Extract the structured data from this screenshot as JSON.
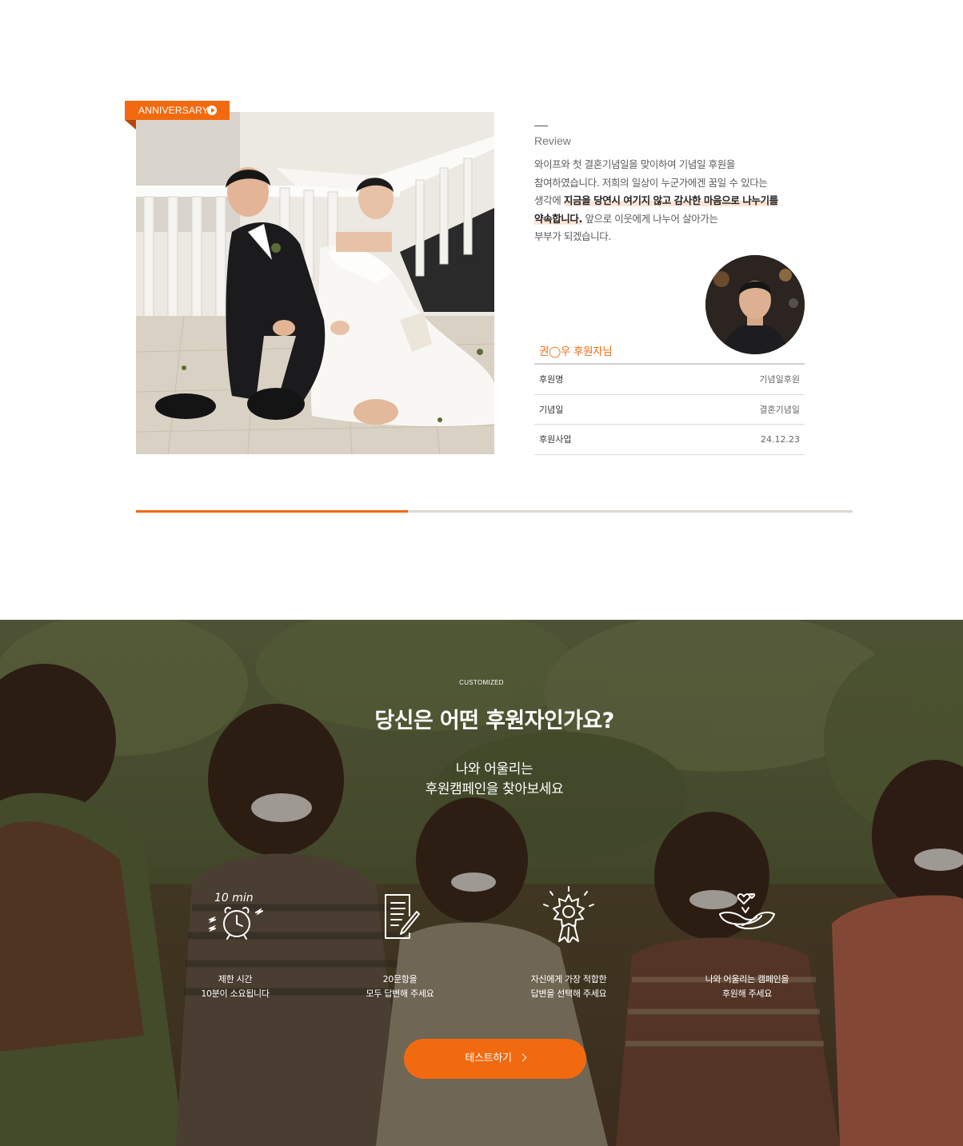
{
  "review": {
    "tag_label": "ANNIVERSARY",
    "heading": "Review",
    "text_line1": "와이프와 첫 결혼기념일을 맞이하여 기념일 후원을",
    "text_line2": "참여하였습니다. 저희의 일상이 누군가에겐 꿈일 수 있다는",
    "text_line3_pre": "생각에 ",
    "text_line3_hl": "지금을 당연시 여기지 않고 감사한 마음으로 나누기를",
    "text_line4_hl": "약속합니다.",
    "text_line4_post": " 앞으로 이웃에게 나누어 살아가는",
    "text_line5": "부부가 되겠습니다.",
    "sponsor_name": "권◯우 후원자님",
    "rows": [
      {
        "key": "후원명",
        "value": "기념일후원"
      },
      {
        "key": "기념일",
        "value": "결혼기념일"
      },
      {
        "key": "후원사업",
        "value": "24.12.23"
      }
    ],
    "carousel_progress": 0.38
  },
  "custom": {
    "eyebrow": "CUSTOMIZED",
    "headline": "당신은 어떤 후원자인가요?",
    "sub_line1": "나와 어울리는",
    "sub_line2": "후원캠페인을 찾아보세요",
    "steps": [
      {
        "icon": "alarm-clock-icon",
        "icon_text": "10 min",
        "line1": "제한 시간",
        "line2": "10분이 소요됩니다"
      },
      {
        "icon": "document-pen-icon",
        "line1": "20문항을",
        "line2": "모두 답변해 주세요"
      },
      {
        "icon": "award-ribbon-icon",
        "line1": "자신에게 가장 적합한",
        "line2": "답변을 선택해 주세요"
      },
      {
        "icon": "hands-heart-icon",
        "line1": "나와 어울리는 캠페인을",
        "line2": "후원해 주세요"
      }
    ],
    "cta_label": "테스트하기"
  },
  "colors": {
    "accent": "#f26a10",
    "highlight": "#fde5d6"
  }
}
